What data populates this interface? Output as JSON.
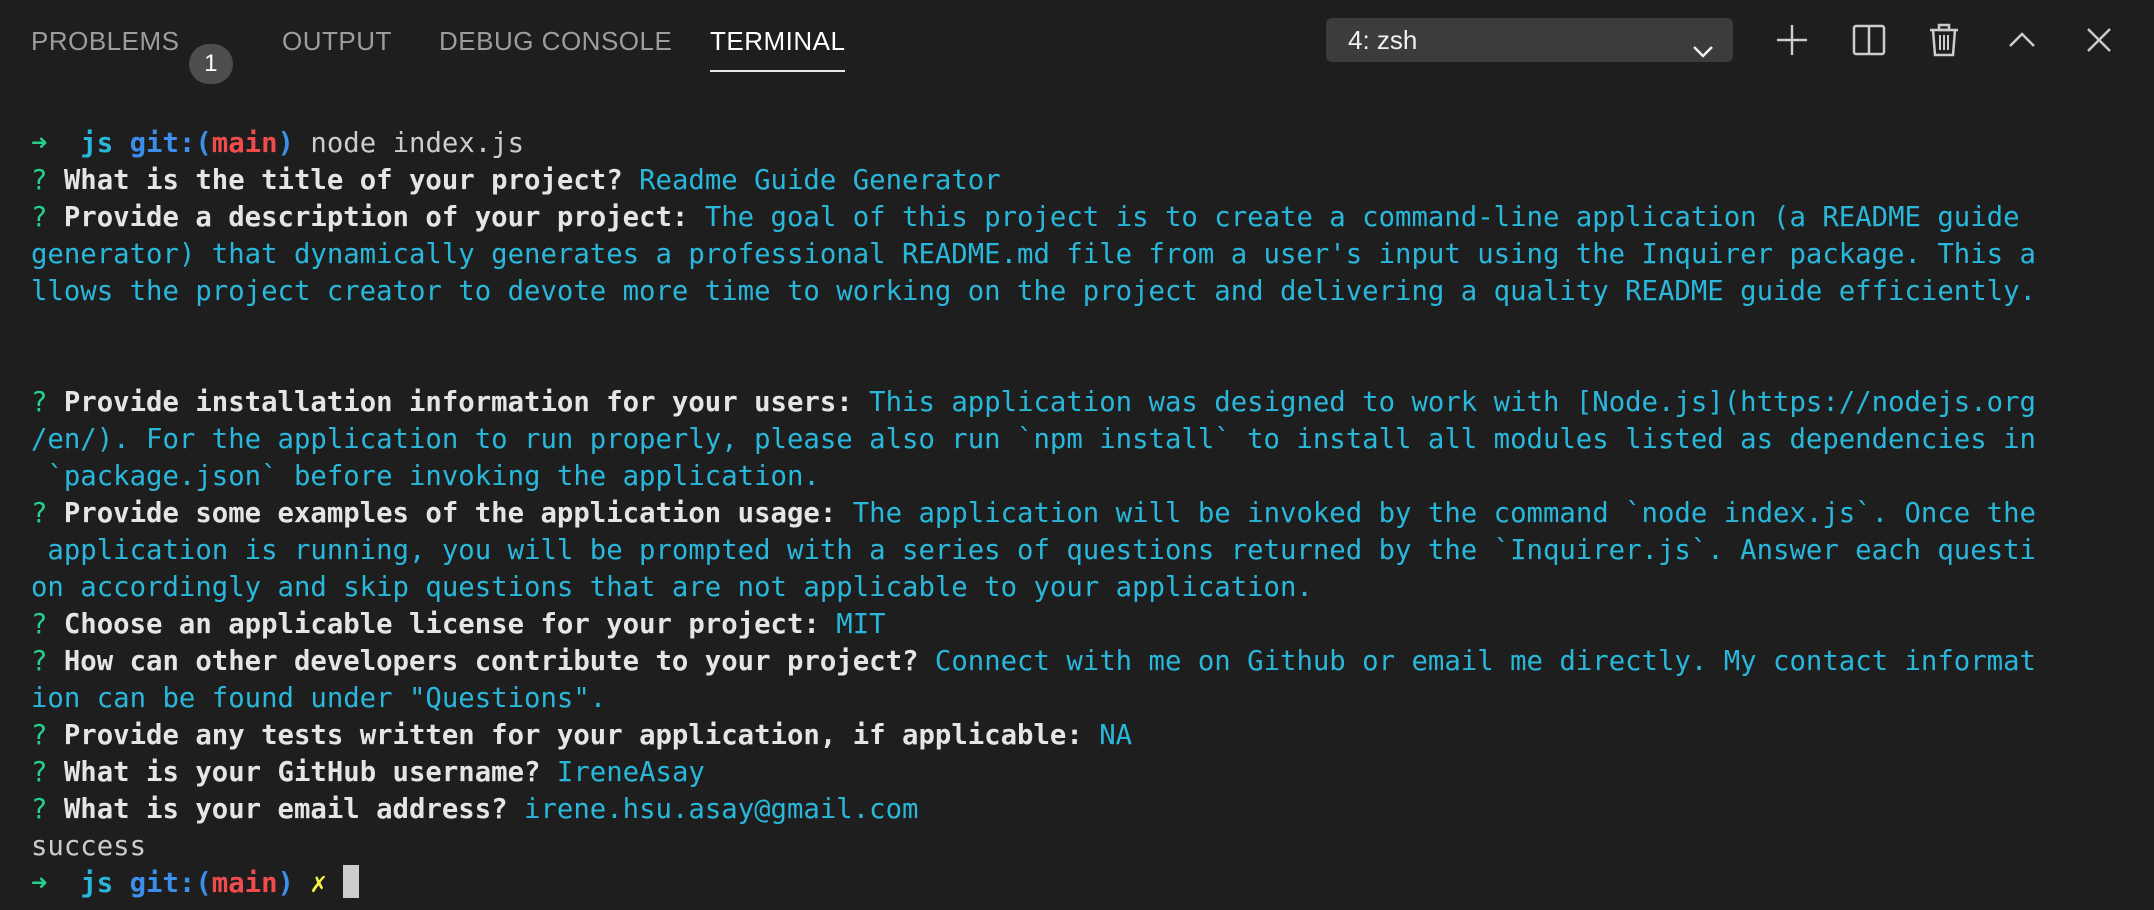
{
  "panel": {
    "tabs": [
      {
        "label": "PROBLEMS",
        "badge": "1"
      },
      {
        "label": "OUTPUT"
      },
      {
        "label": "DEBUG CONSOLE"
      },
      {
        "label": "TERMINAL"
      }
    ],
    "active_tab": "TERMINAL",
    "terminal_select": "4: zsh",
    "actions": [
      "plus-icon",
      "split-icon",
      "trash-icon",
      "chevron-up-icon",
      "close-icon"
    ]
  },
  "terminal": {
    "prompt": {
      "arrow": "➜",
      "dir": "js",
      "git_label": "git:(",
      "branch": "main",
      "git_close": ")",
      "dirty": "✗"
    },
    "command": "node index.js",
    "q_mark": "?",
    "questions": {
      "title": {
        "q": "What is the title of your project?",
        "a": "Readme Guide Generator"
      },
      "description": {
        "q": "Provide a description of your project:",
        "a1": "The goal of this project is to create a command-line application (a README guide",
        "a2": "generator) that dynamically generates a professional README.md file from a user's input using the Inquirer package. This a",
        "a3": "llows the project creator to devote more time to working on the project and delivering a quality README guide efficiently."
      },
      "installation": {
        "q": "Provide installation information for your users:",
        "a1": "This application was designed to work with [Node.js](https://nodejs.org",
        "a2": "/en/). For the application to run properly, please also run `npm install` to install all modules listed as dependencies in",
        "a3": " `package.json` before invoking the application."
      },
      "usage": {
        "q": "Provide some examples of the application usage:",
        "a1": "The application will be invoked by the command `node index.js`. Once the",
        "a2": " application is running, you will be prompted with a series of questions returned by the `Inquirer.js`. Answer each questi",
        "a3": "on accordingly and skip questions that are not applicable to your application."
      },
      "license": {
        "q": "Choose an applicable license for your project:",
        "a": "MIT"
      },
      "contribute": {
        "q": "How can other developers contribute to your project?",
        "a1": "Connect with me on Github or email me directly. My contact informat",
        "a2": "ion can be found under \"Questions\"."
      },
      "tests": {
        "q": "Provide any tests written for your application, if applicable:",
        "a": "NA"
      },
      "github": {
        "q": "What is your GitHub username?",
        "a": "IreneAsay"
      },
      "email": {
        "q": "What is your email address?",
        "a": "irene.hsu.asay@gmail.com"
      }
    },
    "result": "success"
  }
}
